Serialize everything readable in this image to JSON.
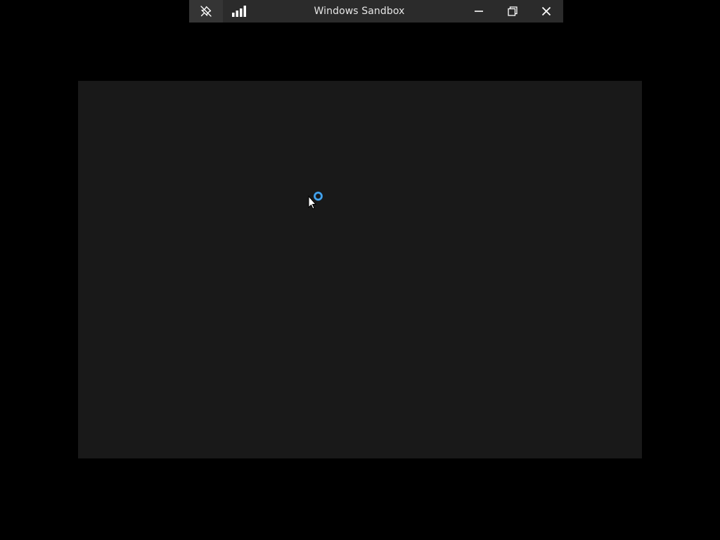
{
  "connection_bar": {
    "title": "Windows Sandbox",
    "background_color": "#2b2b2b",
    "pin_icon": "unpin-icon",
    "signal_icon": "connection-quality-icon",
    "minimize_icon": "minimize-icon",
    "restore_icon": "restore-icon",
    "close_icon": "close-icon"
  },
  "display": {
    "background_color": "#191919",
    "cursor_icon": "busy-pointer-icon",
    "spinner_color": "#3a9be0"
  }
}
